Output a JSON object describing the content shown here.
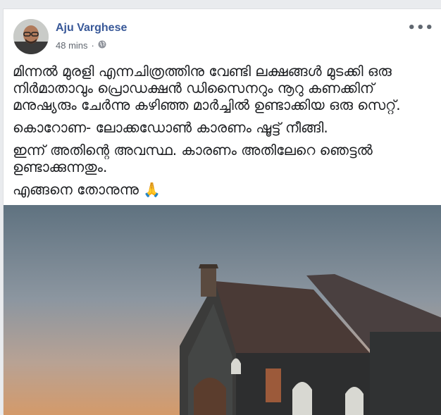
{
  "post": {
    "author": "Aju Varghese",
    "time": "48 mins",
    "separator": "·",
    "privacy_icon": "globe-icon",
    "more_icon": "more-options-icon",
    "more_label": "•••",
    "paragraphs": [
      "മിന്നൽ മുരളി എന്നചിത്രത്തിനു വേണ്ടി ലക്ഷങ്ങൾ മുടക്കി ഒരു നിർമാതാവും പ്രൊഡക്ഷൻ ഡിസൈനറും നൂറു കണക്കിന് മനുഷ്യരും ചേർന്നു കഴിഞ്ഞ മാർച്ചിൽ ഉണ്ടാക്കിയ ഒരു സെറ്റ്.",
      "കൊറോണ- ലോക്കഡോൺ കാരണം ഷൂട്ട് നീങ്ങി.",
      "ഇന്ന് അതിന്റെ അവസ്ഥ. കാരണം അതിലേറെ ഞെട്ടൽ ഉണ്ടാക്കുന്നതും.",
      "എങ്ങനെ തോനുന്നു 🙏"
    ],
    "image_description_icon": "church-photo"
  },
  "colors": {
    "author": "#385898",
    "meta": "#616770",
    "text": "#1c1e21",
    "background": "#e9ebee"
  }
}
